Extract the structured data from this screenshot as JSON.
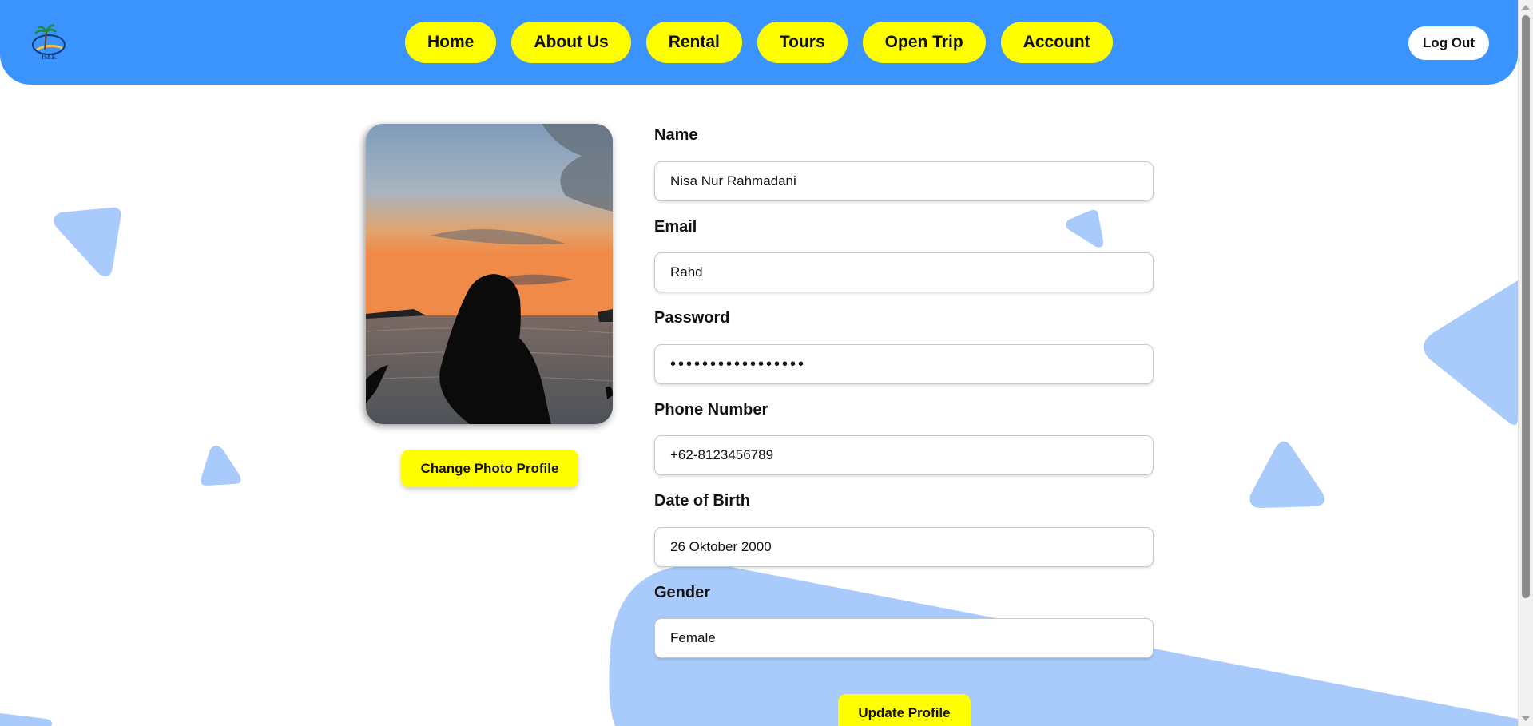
{
  "brand": {
    "logo_text": "ISLE"
  },
  "nav": {
    "items": [
      {
        "label": "Home",
        "name": "nav-home"
      },
      {
        "label": "About Us",
        "name": "nav-about-us"
      },
      {
        "label": "Rental",
        "name": "nav-rental"
      },
      {
        "label": "Tours",
        "name": "nav-tours"
      },
      {
        "label": "Open Trip",
        "name": "nav-open-trip"
      },
      {
        "label": "Account",
        "name": "nav-account"
      }
    ],
    "logout_label": "Log Out"
  },
  "profile": {
    "change_photo_label": "Change Photo Profile"
  },
  "form": {
    "name": {
      "label": "Name",
      "value": "Nisa Nur Rahmadani"
    },
    "email": {
      "label": "Email",
      "value": "Rahd"
    },
    "password": {
      "label": "Password",
      "value": "•••••••••••••••••"
    },
    "phone": {
      "label": "Phone Number",
      "value": "+62-8123456789"
    },
    "dob": {
      "label": "Date of Birth",
      "value": "26 Oktober 2000"
    },
    "gender": {
      "label": "Gender",
      "value": "Female"
    },
    "update_label": "Update Profile"
  },
  "colors": {
    "header_bg": "#3b93fd",
    "accent_yellow": "#ffff00",
    "deco_blue": "#a8cbfb"
  }
}
